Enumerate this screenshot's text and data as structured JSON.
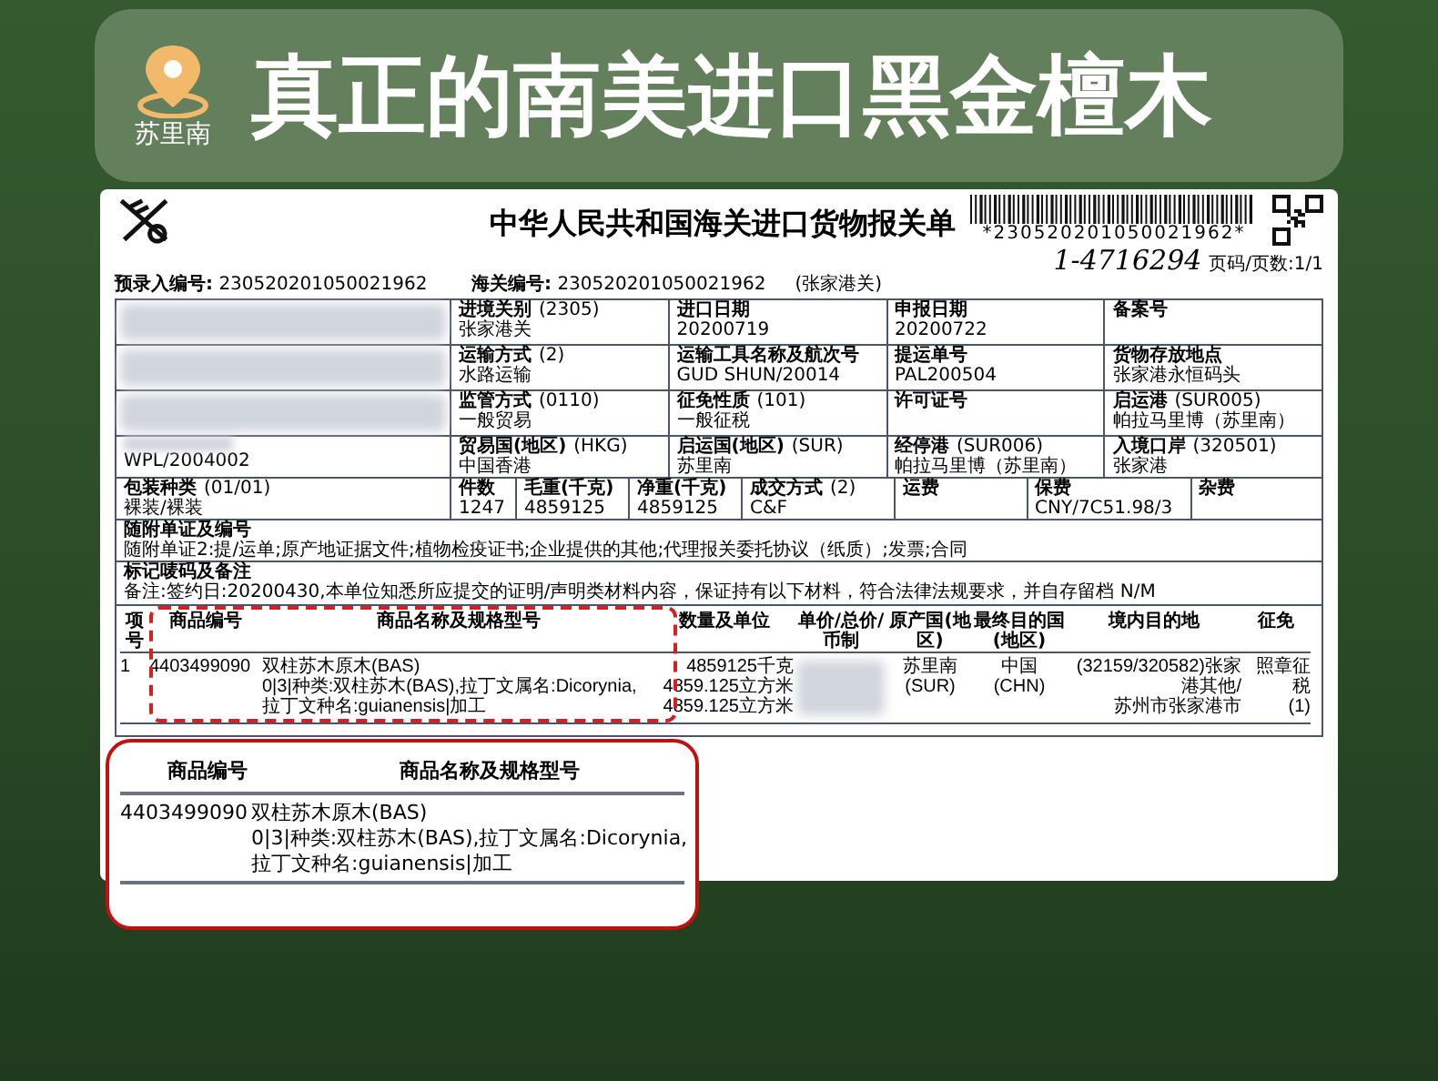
{
  "location_badge": {
    "label": "苏里南"
  },
  "headline": "真正的南美进口黑金檀木",
  "document": {
    "title": "中华人民共和国海关进口货物报关单",
    "barcode_number": "*230520201050021962*",
    "handwritten_note": "1-4716294",
    "page_info": "页码/页数:1/1",
    "pre_entry": {
      "label": "预录入编号:",
      "value": "230520201050021962"
    },
    "customs_no": {
      "label": "海关编号:",
      "value": "230520201050021962"
    },
    "customs_office": "(张家港关)",
    "rows": [
      [
        {
          "kind": "redacted"
        },
        {
          "kind": "field",
          "label": "进境关别",
          "code": "(2305)",
          "value": "张家港关"
        },
        {
          "kind": "field",
          "label": "进口日期",
          "value": "20200719"
        },
        {
          "kind": "field",
          "label": "申报日期",
          "value": "20200722"
        },
        {
          "kind": "field",
          "label": "备案号"
        }
      ],
      [
        {
          "kind": "redacted"
        },
        {
          "kind": "field",
          "label": "运输方式",
          "code": "(2)",
          "value": "水路运输"
        },
        {
          "kind": "field",
          "label": "运输工具名称及航次号",
          "value": "GUD SHUN/20014"
        },
        {
          "kind": "field",
          "label": "提运单号",
          "value": "PAL200504"
        },
        {
          "kind": "field",
          "label": "货物存放地点",
          "value": "张家港永恒码头"
        }
      ],
      [
        {
          "kind": "redacted"
        },
        {
          "kind": "field",
          "label": "监管方式",
          "code": "(0110)",
          "value": "一般贸易"
        },
        {
          "kind": "field",
          "label": "征免性质",
          "code": "(101)",
          "value": "一般征税"
        },
        {
          "kind": "field",
          "label": "许可证号"
        },
        {
          "kind": "field",
          "label": "启运港",
          "code": "(SUR005)",
          "value": "帕拉马里博（苏里南）"
        }
      ],
      [
        {
          "kind": "partial",
          "value": "WPL/2004002"
        },
        {
          "kind": "field",
          "label": "贸易国(地区)",
          "code": "(HKG)",
          "value": "中国香港"
        },
        {
          "kind": "field",
          "label": "启运国(地区)",
          "code": "(SUR)",
          "value": "苏里南"
        },
        {
          "kind": "field",
          "label": "经停港",
          "code": "(SUR006)",
          "value": "帕拉马里博（苏里南）"
        },
        {
          "kind": "field",
          "label": "入境口岸",
          "code": "(320501)",
          "value": "张家港"
        }
      ]
    ],
    "summary_row": [
      {
        "kind": "field",
        "label": "包装种类",
        "code": "(01/01)",
        "value": "裸装/裸装"
      },
      {
        "kind": "field",
        "label": "件数",
        "value": "1247"
      },
      {
        "kind": "field",
        "label": "毛重(千克)",
        "value": "4859125"
      },
      {
        "kind": "field",
        "label": "净重(千克)",
        "value": "4859125"
      },
      {
        "kind": "field",
        "label": "成交方式",
        "code": "(2)",
        "value": "C&F"
      },
      {
        "kind": "field",
        "label": "运费"
      },
      {
        "kind": "field",
        "label": "保费",
        "value": "CNY/7C51.98/3"
      },
      {
        "kind": "field",
        "label": "杂费"
      }
    ],
    "attachments": {
      "label": "随附单证及编号",
      "value": "随附单证2:提/运单;原产地证据文件;植物检疫证书;企业提供的其他;代理报关委托协议（纸质）;发票;合同"
    },
    "remarks": {
      "label": "标记唛码及备注",
      "value": "备注:签约日:20200430,本单位知悉所应提交的证明/声明类材料内容，保证持有以下材料，符合法律法规要求，并自存留档 N/M"
    },
    "goods": {
      "columns": [
        "项号",
        "商品编号",
        "商品名称及规格型号",
        "数量及单位",
        "单价/总价/币制",
        "原产国(地区)",
        "最终目的国(地区)",
        "境内目的地",
        "征免"
      ],
      "rows": [
        {
          "cells": [
            {
              "kind": "text",
              "lines": [
                "1"
              ]
            },
            {
              "kind": "text",
              "lines": [
                "4403499090"
              ]
            },
            {
              "kind": "text",
              "lines": [
                "双柱苏木原木(BAS)",
                "0|3|种类:双柱苏木(BAS),拉丁文属名:Dicorynia,",
                "拉丁文种名:guianensis|加工"
              ]
            },
            {
              "kind": "text",
              "lines": [
                "4859125千克",
                "4859.125立方米",
                "4859.125立方米"
              ]
            },
            {
              "kind": "redacted"
            },
            {
              "kind": "text",
              "lines": [
                "苏里南",
                "(SUR)"
              ]
            },
            {
              "kind": "text",
              "lines": [
                "中国",
                "(CHN)"
              ]
            },
            {
              "kind": "text",
              "lines": [
                "(32159/320582)张家港其他/",
                "苏州市张家港市"
              ]
            },
            {
              "kind": "text",
              "lines": [
                "照章征税",
                "(1)"
              ]
            }
          ]
        }
      ]
    }
  },
  "magnified": {
    "columns": [
      "商品编号",
      "商品名称及规格型号"
    ],
    "hs_code": "4403499090",
    "name_lines": [
      "双柱苏木原木(BAS)",
      "0|3|种类:双柱苏木(BAS),拉丁文属名:Dicorynia,",
      "拉丁文种名:guianensis|加工"
    ]
  }
}
